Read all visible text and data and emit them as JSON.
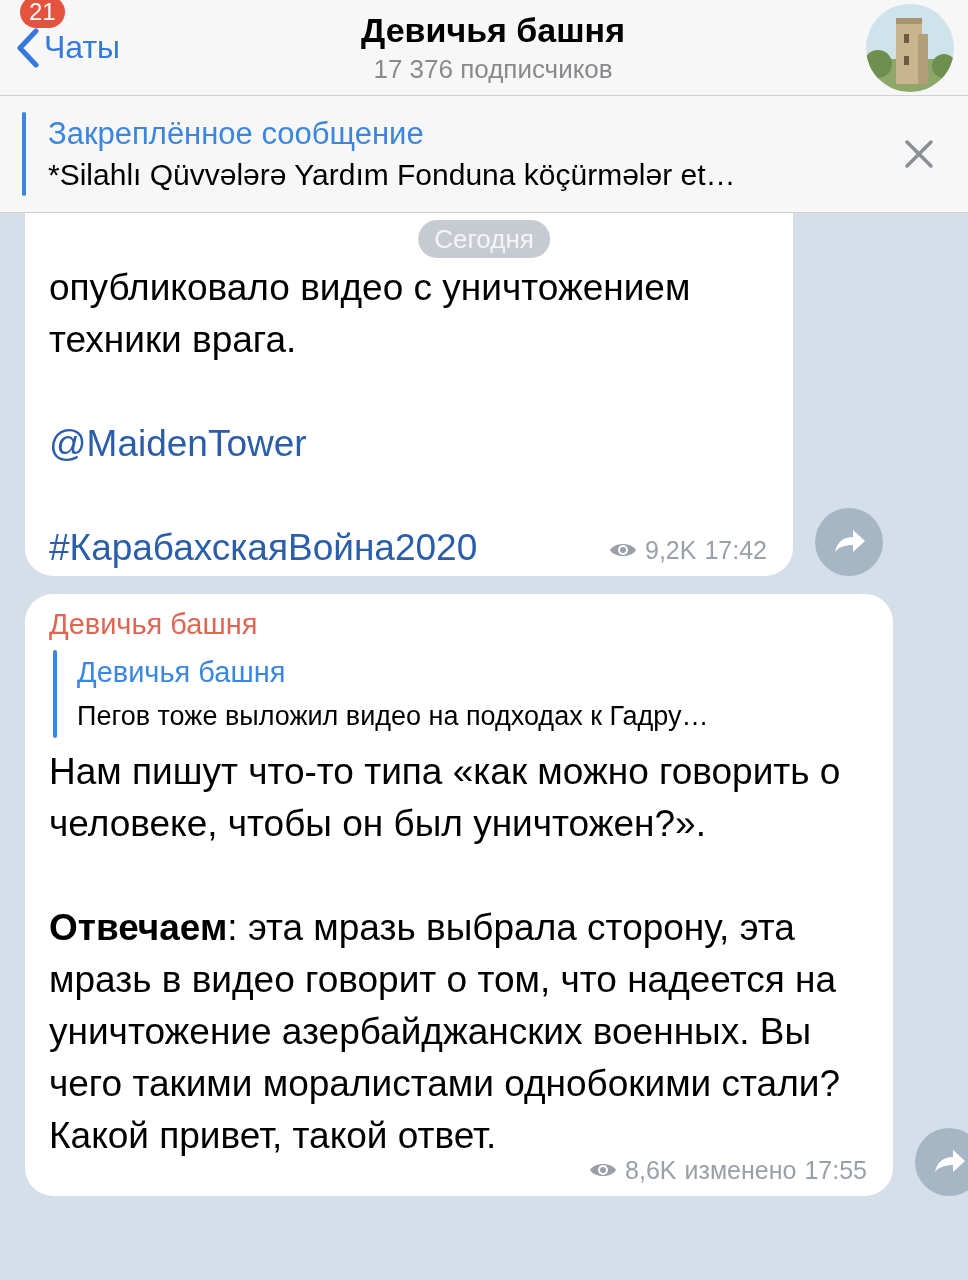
{
  "header": {
    "back_label": "Чаты",
    "unread_badge": "21",
    "title": "Девичья башня",
    "subtitle": "17 376 подписчиков"
  },
  "pinned": {
    "title": "Закреплённое сообщение",
    "text": "*Silahlı Qüvvələrə Yardım Fonduna köçürmələr et…"
  },
  "date_chip": "Сегодня",
  "messages": [
    {
      "cut_top": true,
      "blocks": [
        {
          "kind": "text",
          "text": "опубликовало видео с уничтожением техники врага."
        },
        {
          "kind": "link",
          "text": "@MaidenTower"
        },
        {
          "kind": "link",
          "text": "#КарабахскаяВойна2020"
        }
      ],
      "views": "9,2K",
      "time": "17:42"
    },
    {
      "cut_top": false,
      "sender": "Девичья башня",
      "reply": {
        "author": "Девичья башня",
        "text": "Пегов тоже выложил видео на подходах к Гадру…"
      },
      "blocks": [
        {
          "kind": "text",
          "text": "Нам пишут что-то типа «как можно говорить о человеке, чтобы он был уничтожен?»."
        },
        {
          "kind": "text",
          "text": "**Отвечаем**: эта мразь выбрала сторону, эта мразь в видео говорит о том, что надеется на уничтожение азербайджанских военных. Вы чего такими моралистами однобокими стали? Какой привет, такой ответ."
        }
      ],
      "views": "8,6K",
      "edited": "изменено",
      "time": "17:55"
    }
  ]
}
